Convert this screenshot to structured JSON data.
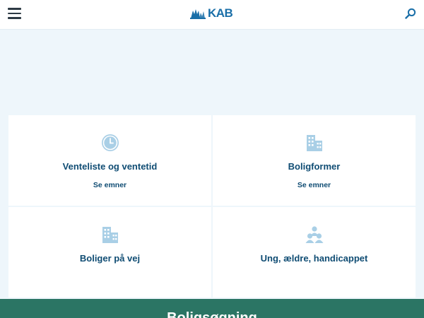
{
  "header": {
    "logo_text": "KAB",
    "menu_icon": "hamburger-icon",
    "search_icon": "search-icon",
    "brand_color": "#1a6fa8"
  },
  "cards": [
    {
      "title": "Venteliste og ventetid",
      "link": "Se emner",
      "icon": "clock-icon"
    },
    {
      "title": "Boligformer",
      "link": "Se emner",
      "icon": "buildings-icon"
    },
    {
      "title": "Boliger på vej",
      "icon": "buildings-icon"
    },
    {
      "title": "Ung, ældre, handicappet",
      "icon": "people-icon"
    }
  ],
  "footer": {
    "title": "Boligsøgning",
    "color": "#2b7564"
  }
}
